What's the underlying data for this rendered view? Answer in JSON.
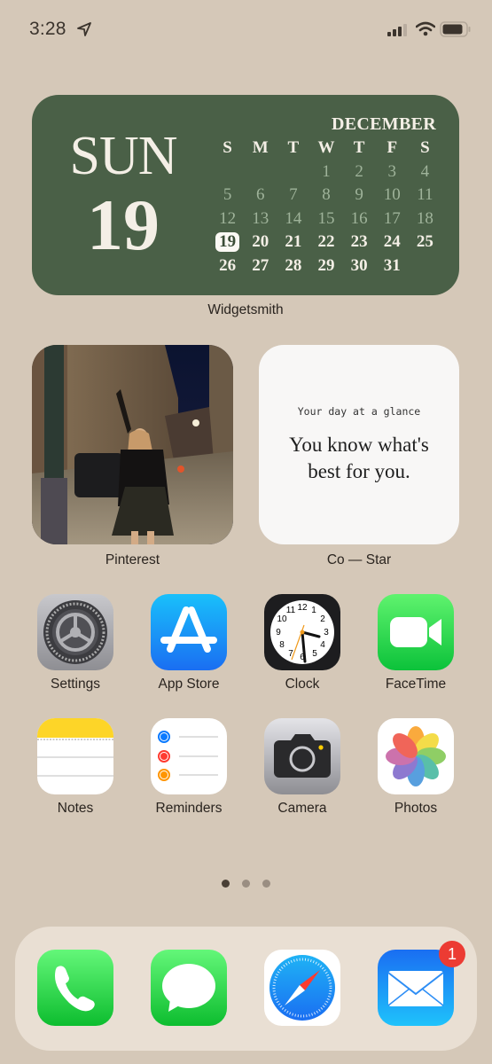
{
  "status_bar": {
    "time": "3:28",
    "icons": [
      "location-arrow-icon",
      "cellular-signal-icon",
      "wifi-icon",
      "battery-icon"
    ]
  },
  "calendar_widget": {
    "weekday": "SUN",
    "date": "19",
    "month": "DECEMBER",
    "weekday_headers": [
      "S",
      "M",
      "T",
      "W",
      "T",
      "F",
      "S"
    ],
    "days": [
      "",
      "",
      "",
      "1",
      "2",
      "3",
      "4",
      "5",
      "6",
      "7",
      "8",
      "9",
      "10",
      "11",
      "12",
      "13",
      "14",
      "15",
      "16",
      "17",
      "18",
      "19",
      "20",
      "21",
      "22",
      "23",
      "24",
      "25",
      "26",
      "27",
      "28",
      "29",
      "30",
      "31",
      ""
    ],
    "today": "19",
    "label": "Widgetsmith",
    "colors": {
      "background": "#4a6047",
      "past_days": "#9fb39a",
      "text": "#f4efe6"
    }
  },
  "photo_widget": {
    "label": "Pinterest",
    "image_description": "woman posing on night city street"
  },
  "costar_widget": {
    "subtitle": "Your day at a glance",
    "message": "You know what's best for you.",
    "label": "Co — Star"
  },
  "apps_row1": [
    {
      "name": "Settings",
      "icon": "settings-gear-icon"
    },
    {
      "name": "App Store",
      "icon": "app-store-icon"
    },
    {
      "name": "Clock",
      "icon": "clock-icon"
    },
    {
      "name": "FaceTime",
      "icon": "facetime-camera-icon"
    }
  ],
  "apps_row2": [
    {
      "name": "Notes",
      "icon": "notes-icon"
    },
    {
      "name": "Reminders",
      "icon": "reminders-icon"
    },
    {
      "name": "Camera",
      "icon": "camera-icon"
    },
    {
      "name": "Photos",
      "icon": "photos-flower-icon"
    }
  ],
  "page_indicator": {
    "pages": 3,
    "current": 1
  },
  "dock": [
    {
      "name": "Phone",
      "icon": "phone-icon"
    },
    {
      "name": "Messages",
      "icon": "messages-icon"
    },
    {
      "name": "Safari",
      "icon": "safari-compass-icon"
    },
    {
      "name": "Mail",
      "icon": "mail-icon",
      "badge": "1"
    }
  ],
  "colors": {
    "wallpaper": "#d5c8b8",
    "dock": "#e9dfd3",
    "badge": "#ec3b33"
  }
}
